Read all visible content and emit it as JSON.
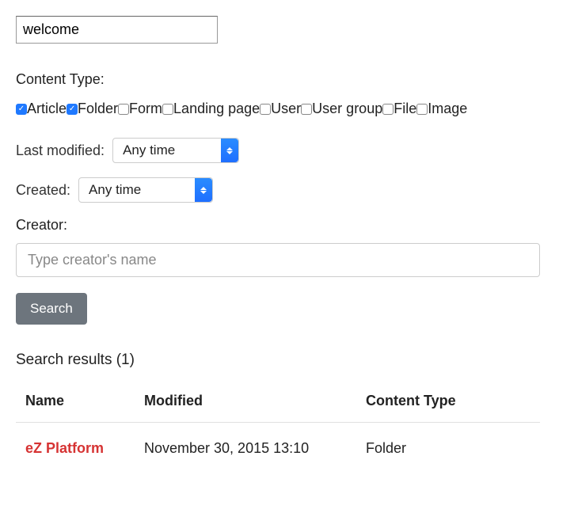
{
  "search": {
    "value": "welcome"
  },
  "contentType": {
    "label": "Content Type:",
    "items": [
      {
        "label": "Article",
        "checked": true
      },
      {
        "label": "Folder",
        "checked": true
      },
      {
        "label": "Form",
        "checked": false
      },
      {
        "label": "Landing page",
        "checked": false
      },
      {
        "label": "User",
        "checked": false
      },
      {
        "label": "User group",
        "checked": false
      },
      {
        "label": "File",
        "checked": false
      },
      {
        "label": "Image",
        "checked": false
      }
    ]
  },
  "lastModified": {
    "label": "Last modified:",
    "value": "Any time"
  },
  "created": {
    "label": "Created:",
    "value": "Any time"
  },
  "creator": {
    "label": "Creator:",
    "placeholder": "Type creator's name",
    "value": ""
  },
  "searchButton": "Search",
  "results": {
    "heading": "Search results (1)",
    "columns": {
      "name": "Name",
      "modified": "Modified",
      "contentType": "Content Type"
    },
    "rows": [
      {
        "name": "eZ Platform",
        "modified": "November 30, 2015 13:10",
        "contentType": "Folder"
      }
    ]
  }
}
